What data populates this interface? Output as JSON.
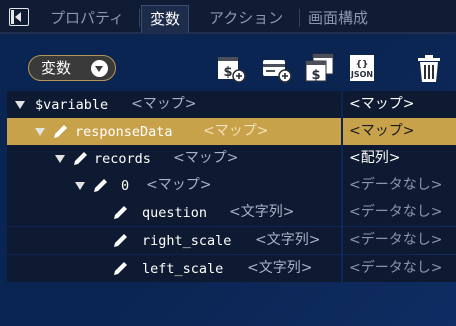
{
  "tabs": [
    {
      "label": "プロパティ",
      "active": false
    },
    {
      "label": "変数",
      "active": true
    },
    {
      "label": "アクション",
      "active": false
    },
    {
      "label": "画面構成",
      "active": false
    }
  ],
  "toolbar": {
    "variable_select": "変数",
    "buttons": [
      {
        "icon": "add-dollar-document-icon"
      },
      {
        "icon": "add-card-icon"
      },
      {
        "icon": "copy-dollar-icon"
      },
      {
        "icon": "json-icon",
        "label": "JSON"
      },
      {
        "icon": "trash-icon"
      }
    ]
  },
  "tree": {
    "rows": [
      {
        "name": "$variable",
        "type": "<マップ>",
        "value": "<マップ>",
        "expanded": true,
        "selected": false
      },
      {
        "name": "responseData",
        "type": "<マップ>",
        "value": "<マップ>",
        "expanded": true,
        "selected": true
      },
      {
        "name": "records",
        "type": "<マップ>",
        "value": "<配列>",
        "expanded": true,
        "selected": false
      },
      {
        "name": "0",
        "type": "<マップ>",
        "value": "<データなし>",
        "expanded": true,
        "selected": false
      },
      {
        "name": "question",
        "type": "<文字列>",
        "value": "<データなし>",
        "selected": false
      },
      {
        "name": "right_scale",
        "type": "<文字列>",
        "value": "<データなし>",
        "selected": false
      },
      {
        "name": "left_scale",
        "type": "<文字列>",
        "value": "<データなし>",
        "selected": false
      }
    ]
  },
  "colors": {
    "selected_row": "#c8a24a",
    "background": "#0b2553",
    "row_bg": "#0e1a31"
  }
}
